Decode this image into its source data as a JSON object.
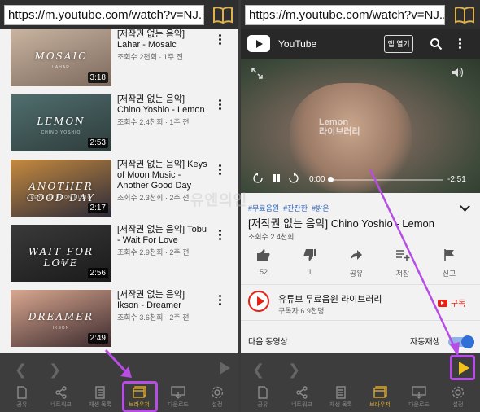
{
  "left": {
    "url": "https://m.youtube.com/watch?v=NJ...",
    "videos": [
      {
        "thumb_title": "MOSAIC",
        "thumb_sub": "LAHAR",
        "duration": "3:18",
        "title": "[저작권 없는 음악] Lahar - Mosaic",
        "meta": "조회수 2천회 · 1주 전",
        "colors": [
          "#c9b3a0",
          "#7c6a5e"
        ]
      },
      {
        "thumb_title": "LEMON",
        "thumb_sub": "CHINO YOSHIO",
        "duration": "2:53",
        "title": "[저작권 없는 음악] Chino Yoshio - Lemon",
        "meta": "조회수 2.4천회 · 1주 전",
        "colors": [
          "#506e6e",
          "#2e3c3b"
        ]
      },
      {
        "thumb_title": "ANOTHER GOOD DAY",
        "thumb_sub": "KEYS OF MOON MUSIC",
        "duration": "2:17",
        "title": "[저작권 없는 음악] Keys of Moon Music - Another Good Day",
        "meta": "조회수 2.3천회 · 2주 전",
        "colors": [
          "#c58a3e",
          "#2b2a3a"
        ]
      },
      {
        "thumb_title": "WAIT FOR LOVE",
        "thumb_sub": "TOBU",
        "duration": "2:56",
        "title": "[저작권 없는 음악] Tobu - Wait For Love",
        "meta": "조회수 2.9천회 · 2주 전",
        "colors": [
          "#3a3a3a",
          "#1a1a1a"
        ]
      },
      {
        "thumb_title": "DREAMER",
        "thumb_sub": "IKSON",
        "duration": "2:49",
        "title": "[저작권 없는 음악] Ikson - Dreamer",
        "meta": "조회수 3.6천회 · 2주 전",
        "colors": [
          "#d9a78f",
          "#3b2a2e"
        ]
      }
    ],
    "tabs": [
      "공유",
      "네트워크",
      "재생 목록",
      "브라우저",
      "다운로드",
      "설정"
    ],
    "active_tab": 3
  },
  "right": {
    "url": "https://m.youtube.com/watch?v=NJ...",
    "header_title": "YouTube",
    "open_app": "앱 열기",
    "overlay_text": [
      "Lemon",
      "라이브러리"
    ],
    "player": {
      "time_current": "0:00",
      "time_remaining": "-2:51",
      "progress": 0.02
    },
    "tags": [
      "#무료음원",
      "#잔잔한",
      "#밝은"
    ],
    "video_title": "[저작권 없는 음악] Chino Yoshio - Lemon",
    "views": "조회수 2.4천회",
    "actions": [
      {
        "icon": "like-icon",
        "label": "52"
      },
      {
        "icon": "dislike-icon",
        "label": "1"
      },
      {
        "icon": "share-icon",
        "label": "공유"
      },
      {
        "icon": "save-icon",
        "label": "저장"
      },
      {
        "icon": "report-icon",
        "label": "신고"
      }
    ],
    "channel_name": "유튜브 무료음원 라이브러리",
    "channel_subs": "구독자 6.9천명",
    "subscribe": "구독",
    "next_up": "다음 동영상",
    "autoplay": "자동재생",
    "tabs": [
      "공유",
      "네트워크",
      "재생 목록",
      "브라우저",
      "다운로드",
      "설정"
    ],
    "active_tab": 3
  },
  "watermark": "유엔의인",
  "colors": {
    "highlight": "#b84de6",
    "active_tab": "#d9a930",
    "youtube_red": "#e62117",
    "play_yellow": "#f2c21b"
  }
}
